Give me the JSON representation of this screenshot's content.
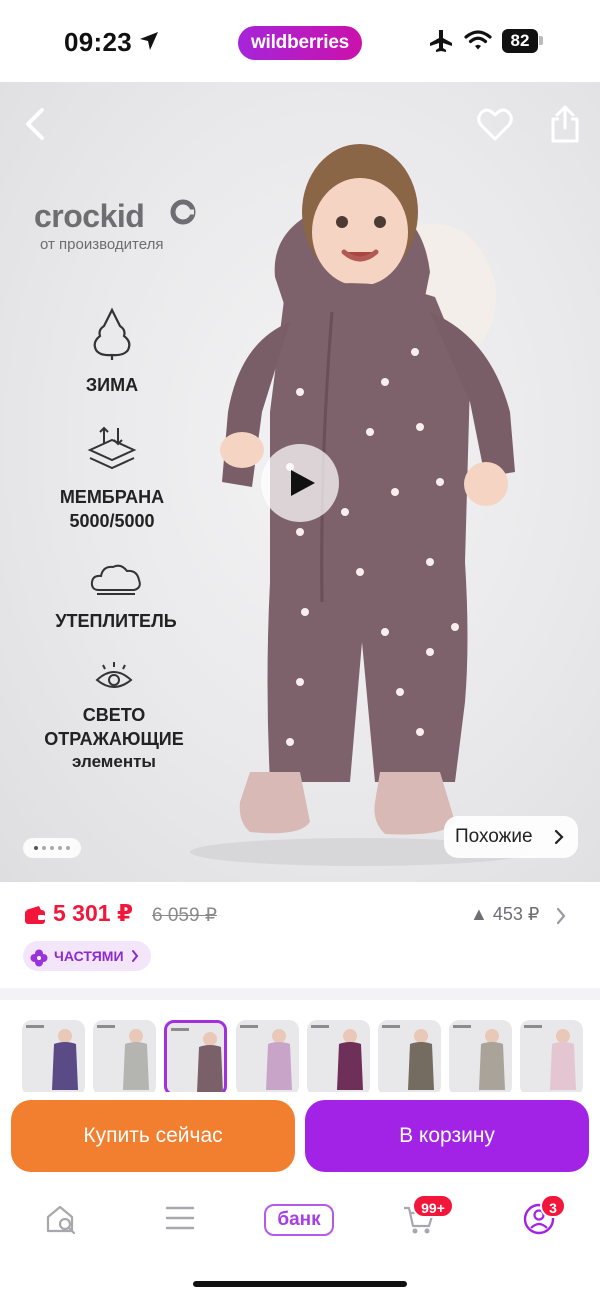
{
  "status_bar": {
    "time": "09:23",
    "app_pill": "wildberries",
    "battery": "82"
  },
  "hero": {
    "brand": "crockid",
    "brand_sub": "от производителя",
    "features": [
      {
        "icon": "fir-tree-icon",
        "lines": [
          "ЗИМА"
        ],
        "sub": ""
      },
      {
        "icon": "membrane-icon",
        "lines": [
          "МЕМБРАНА",
          "5000/5000"
        ],
        "sub": ""
      },
      {
        "icon": "cloud-insulation-icon",
        "lines": [
          "УТЕПЛИТЕЛЬ"
        ],
        "sub": ""
      },
      {
        "icon": "eye-icon",
        "lines": [
          "СВЕТО",
          "ОТРАЖАЮЩИЕ"
        ],
        "sub": "элементы"
      }
    ],
    "similar_label": "Похожие",
    "carousel_dots": 5,
    "carousel_active": 0
  },
  "product": {
    "price": "5 301 ₽",
    "old_price": "6 059 ₽",
    "price_history": "▲ 453 ₽",
    "installments_label": "ЧАСТЯМИ"
  },
  "thumbnails": [
    {
      "color": "#5a4a86"
    },
    {
      "color": "#b4b4b0"
    },
    {
      "color": "#7a6068",
      "active": true
    },
    {
      "color": "#c9a4c9"
    },
    {
      "color": "#6e2f58"
    },
    {
      "color": "#746b61"
    },
    {
      "color": "#a9a39a"
    },
    {
      "color": "#e3c6d2"
    }
  ],
  "actions": {
    "buy_now": "Купить сейчас",
    "add_to_cart": "В корзину"
  },
  "tabbar": {
    "bank_label": "банк",
    "cart_badge": "99+",
    "profile_badge": "3"
  },
  "colors": {
    "accent": "#a223e6",
    "buy": "#f17f2f",
    "price": "#f3163b"
  }
}
